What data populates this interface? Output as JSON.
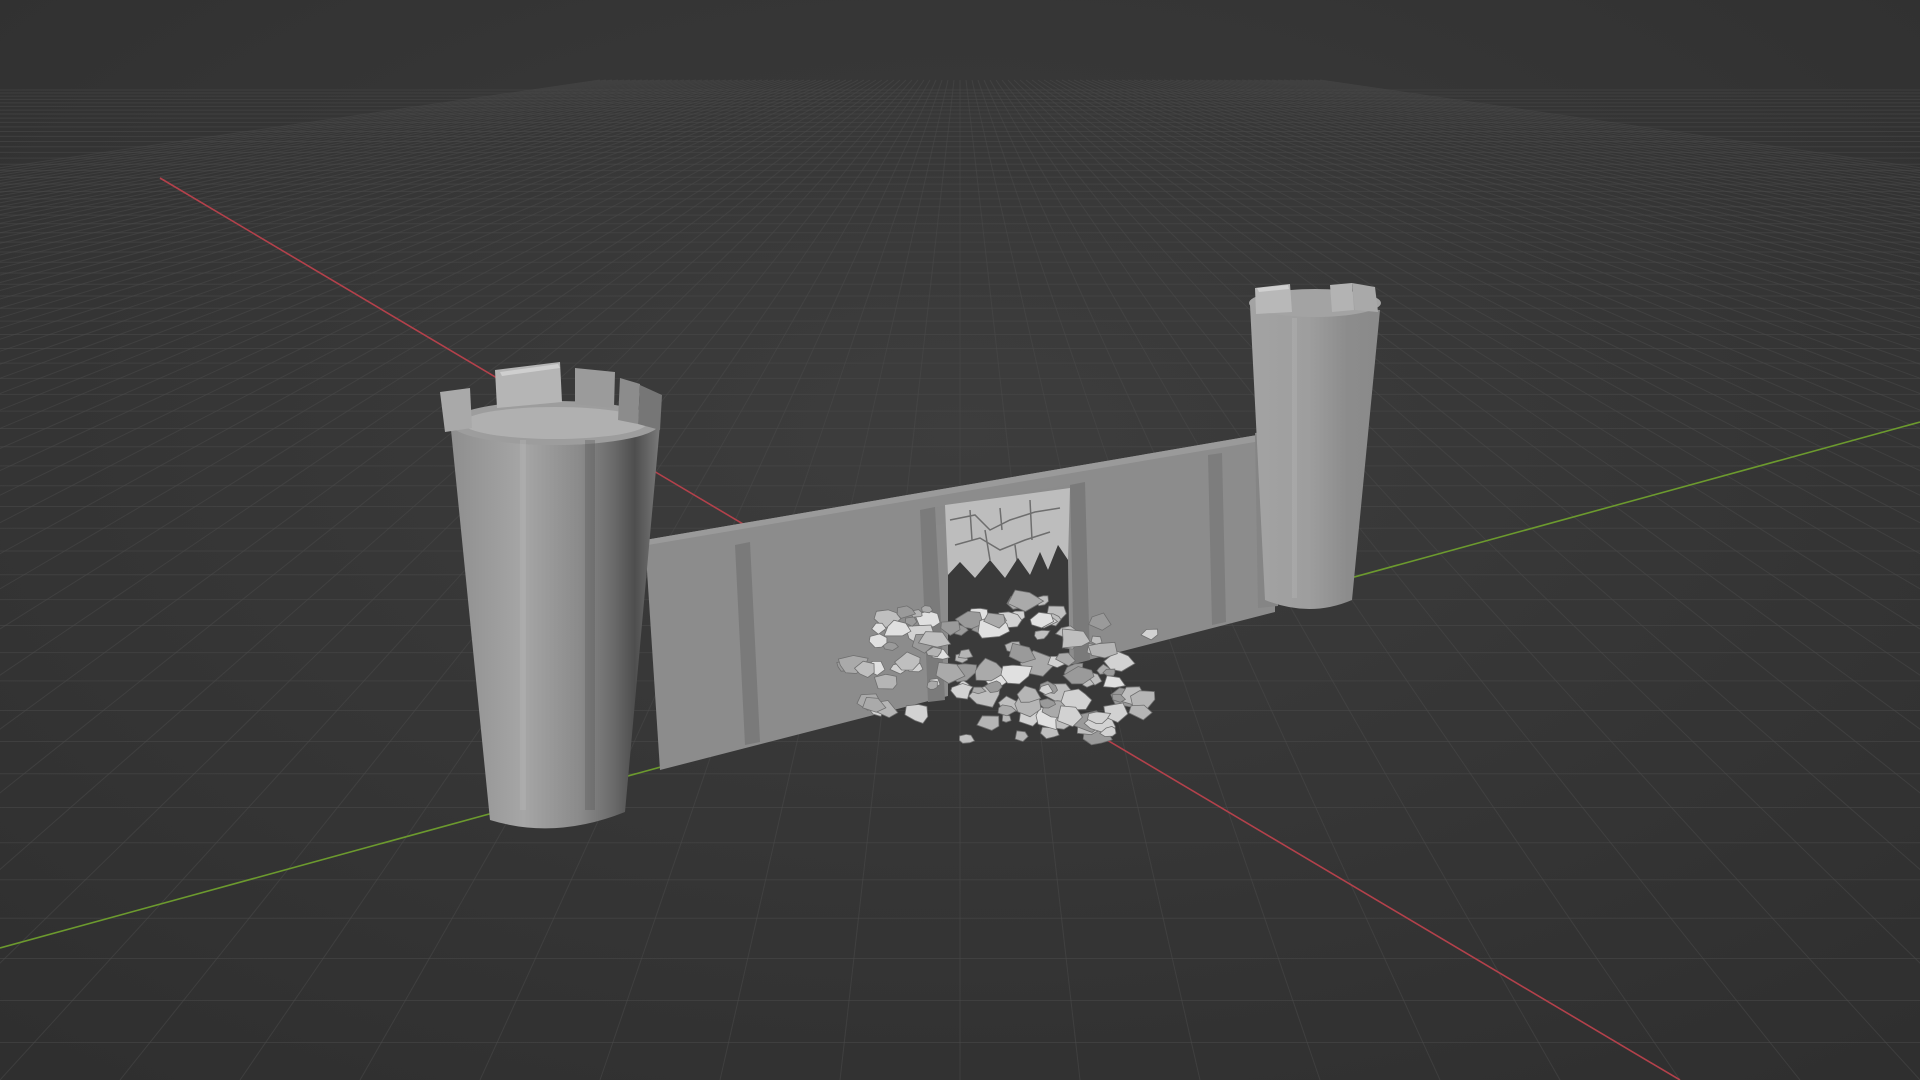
{
  "app": "3D viewport",
  "viewport": {
    "view": "perspective",
    "background_color": "#3a3a3a",
    "grid_color": "#4a4a4a",
    "x_axis_color": "#b3414b",
    "y_axis_color": "#6c9a2e",
    "overlay_text": ""
  },
  "scene": {
    "objects": [
      {
        "name": "left-tower",
        "type": "cylinder-tower",
        "shaded_color": "#9a9a9a"
      },
      {
        "name": "right-tower",
        "type": "cylinder-tower",
        "shaded_color": "#9a9a9a"
      },
      {
        "name": "castle-wall",
        "type": "wall",
        "shaded_color": "#8a8a8a"
      },
      {
        "name": "broken-gate",
        "type": "gate-opening",
        "shaded_color": "#7e7e7e"
      },
      {
        "name": "rubble-pile",
        "type": "debris",
        "shaded_color": "#c9c9c9"
      }
    ]
  }
}
